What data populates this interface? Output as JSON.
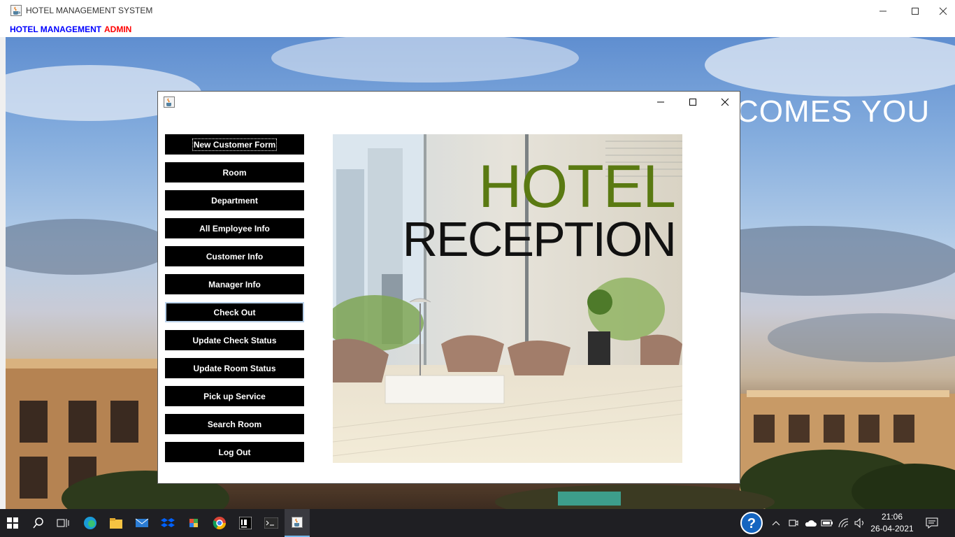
{
  "window": {
    "title": "HOTEL MANAGEMENT SYSTEM",
    "icon": "java-cup-icon"
  },
  "menubar": {
    "hotel_management": "HOTEL MANAGEMENT",
    "admin": "ADMIN",
    "colors": {
      "hotel_management": "#0000ff",
      "admin": "#ff0000"
    }
  },
  "background": {
    "welcome_text": "COMES YOU"
  },
  "dialog": {
    "icon": "java-cup-icon",
    "buttons": [
      {
        "label": "New Customer Form",
        "state": "focused"
      },
      {
        "label": "Room"
      },
      {
        "label": "Department"
      },
      {
        "label": "All Employee Info"
      },
      {
        "label": "Customer Info"
      },
      {
        "label": "Manager Info"
      },
      {
        "label": "Check Out",
        "state": "hover"
      },
      {
        "label": "Update Check Status"
      },
      {
        "label": "Update Room Status"
      },
      {
        "label": "Pick up Service"
      },
      {
        "label": "Search Room"
      },
      {
        "label": "Log Out"
      }
    ],
    "picture": {
      "line1": "HOTEL",
      "line2": "RECEPTION",
      "colors": {
        "line1": "#5a7a12",
        "line2": "#111111"
      }
    }
  },
  "taskbar": {
    "icons": [
      "windows-start-icon",
      "search-icon",
      "task-view-icon",
      "edge-icon",
      "file-explorer-icon",
      "mail-icon",
      "dropbox-icon",
      "photos-icon",
      "chrome-icon",
      "intellij-icon",
      "terminal-icon",
      "java-app-icon"
    ],
    "tray_icons": [
      "help-icon",
      "chevron-up-icon",
      "meet-icon",
      "onedrive-cloud-icon",
      "battery-icon",
      "wifi-icon",
      "volume-icon",
      "notification-icon"
    ],
    "time": "21:06",
    "date": "26-04-2021"
  }
}
